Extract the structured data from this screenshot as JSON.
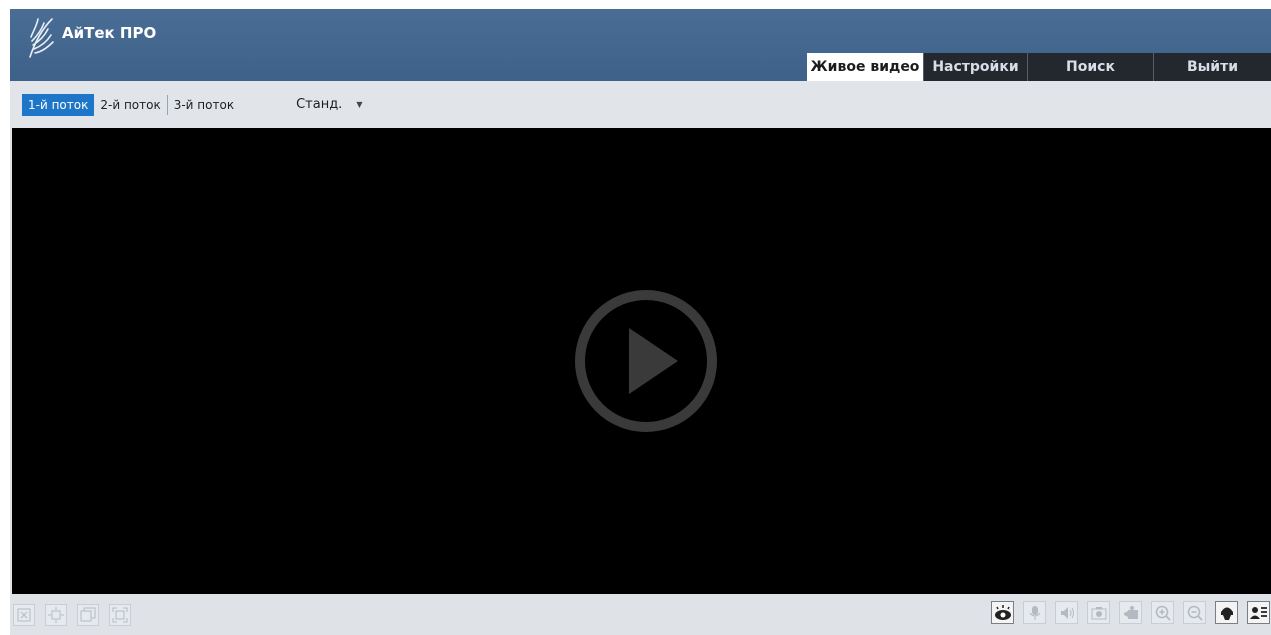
{
  "brand": {
    "name": "АйТек ПРО"
  },
  "nav": {
    "tabs": [
      {
        "label": "Живое видео",
        "active": true
      },
      {
        "label": "Настройки",
        "active": false
      },
      {
        "label": "Поиск",
        "active": false
      },
      {
        "label": "Выйти",
        "active": false
      }
    ]
  },
  "streams": {
    "items": [
      {
        "label": "1-й поток",
        "active": true
      },
      {
        "label": "2-й поток",
        "active": false
      },
      {
        "label": "3-й поток",
        "active": false
      }
    ],
    "quality": "Станд."
  },
  "video": {
    "state": "paused",
    "icon": "play-icon"
  },
  "toolbar": {
    "left": [
      "close-window-icon",
      "move-icon",
      "window-layout-icon",
      "fullscreen-icon"
    ],
    "right": [
      "eye-icon",
      "microphone-icon",
      "speaker-icon",
      "snapshot-icon",
      "record-icon",
      "zoom-in-icon",
      "zoom-out-icon",
      "ptz-dome-icon",
      "user-settings-icon"
    ]
  },
  "colors": {
    "header": "#4a6d95",
    "nav_tab": "#23272e",
    "active_stream": "#1e76c8",
    "video_bg": "#000000"
  }
}
